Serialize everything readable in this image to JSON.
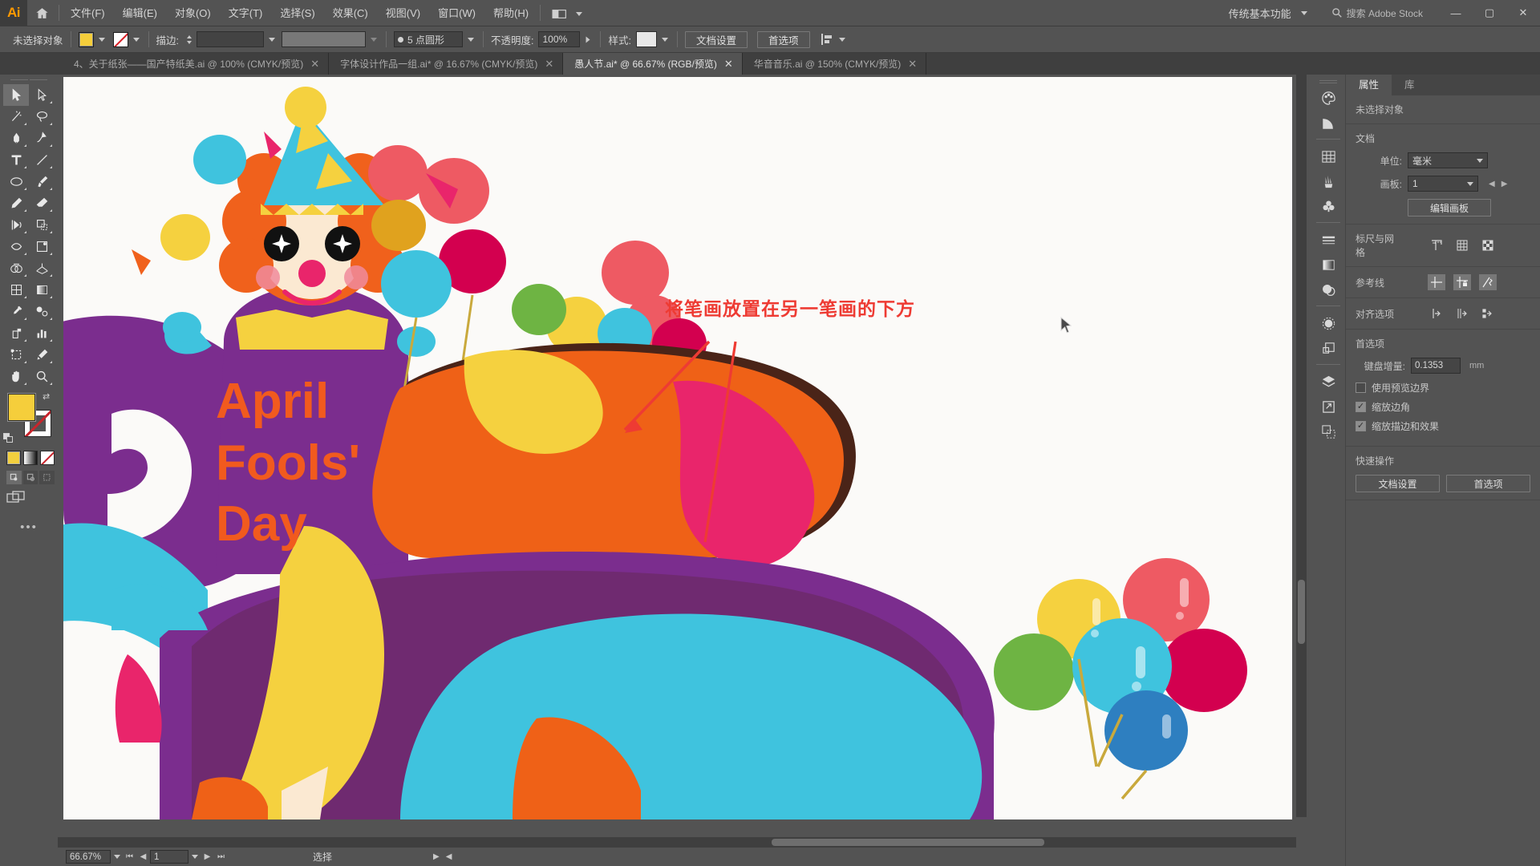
{
  "app": {
    "name": "Adobe Illustrator",
    "logo_text": "Ai",
    "workspace": "传统基本功能",
    "search_placeholder": "搜索 Adobe Stock"
  },
  "menubar": {
    "items": [
      {
        "label": "文件(F)"
      },
      {
        "label": "编辑(E)"
      },
      {
        "label": "对象(O)"
      },
      {
        "label": "文字(T)"
      },
      {
        "label": "选择(S)"
      },
      {
        "label": "效果(C)"
      },
      {
        "label": "视图(V)"
      },
      {
        "label": "窗口(W)"
      },
      {
        "label": "帮助(H)"
      }
    ],
    "window_minimize": "—",
    "window_maximize": "▢",
    "window_close": "✕"
  },
  "controlbar": {
    "selection_status": "未选择对象",
    "fill_color": "#F5CE3B",
    "stroke_label": "描边:",
    "stroke_weight": "",
    "stroke_profile": "",
    "brush_definition": "5 点圆形",
    "opacity_label": "不透明度:",
    "opacity_value": "100%",
    "style_label": "样式:",
    "doc_setup_button": "文档设置",
    "preferences_button": "首选项"
  },
  "tabs": [
    {
      "title": "4、关于纸张——国产特纸美.ai @ 100% (CMYK/预览)",
      "active": false,
      "close": "✕"
    },
    {
      "title": "字体设计作品一组.ai* @ 16.67% (CMYK/预览)",
      "active": false,
      "close": "✕"
    },
    {
      "title": "愚人节.ai* @ 66.67% (RGB/预览)",
      "active": true,
      "close": "✕"
    },
    {
      "title": "华音音乐.ai @ 150% (CMYK/预览)",
      "active": false,
      "close": "✕"
    }
  ],
  "toolbar": {
    "tools": [
      {
        "name": "selection-tool",
        "active": true
      },
      {
        "name": "direct-selection-tool",
        "active": false
      },
      {
        "name": "magic-wand-tool",
        "active": false
      },
      {
        "name": "lasso-tool",
        "active": false
      },
      {
        "name": "pen-tool",
        "active": false
      },
      {
        "name": "curvature-tool",
        "active": false
      },
      {
        "name": "type-tool",
        "active": false
      },
      {
        "name": "line-segment-tool",
        "active": false
      },
      {
        "name": "ellipse-tool",
        "active": false
      },
      {
        "name": "paintbrush-tool",
        "active": false
      },
      {
        "name": "pencil-tool",
        "active": false
      },
      {
        "name": "eraser-tool",
        "active": false
      },
      {
        "name": "rotate-tool",
        "active": false
      },
      {
        "name": "scale-tool",
        "active": false
      },
      {
        "name": "width-tool",
        "active": false
      },
      {
        "name": "free-transform-tool",
        "active": false
      },
      {
        "name": "shape-builder-tool",
        "active": false
      },
      {
        "name": "perspective-grid-tool",
        "active": false
      },
      {
        "name": "mesh-tool",
        "active": false
      },
      {
        "name": "gradient-tool",
        "active": false
      },
      {
        "name": "eyedropper-tool",
        "active": false
      },
      {
        "name": "blend-tool",
        "active": false
      },
      {
        "name": "symbol-sprayer-tool",
        "active": false
      },
      {
        "name": "column-graph-tool",
        "active": false
      },
      {
        "name": "artboard-tool",
        "active": false
      },
      {
        "name": "slice-tool",
        "active": false
      },
      {
        "name": "hand-tool",
        "active": false
      },
      {
        "name": "zoom-tool",
        "active": false
      }
    ],
    "fill_color": "#F5CE3B",
    "stroke_color": "none",
    "dots_label": "•••"
  },
  "canvas": {
    "annotation_text": "将笔画放置在另一笔画的下方",
    "annotation_color": "#EE3B33",
    "artwork_title_lines": [
      "April",
      "Fools'",
      "Day"
    ],
    "artwork_title_color": "#F15A1E",
    "palette": {
      "purple": "#7B2D8E",
      "dark_brown": "#4A2418",
      "orange": "#EF6117",
      "yellow": "#F5D13F",
      "cyan": "#3FC3DE",
      "pink": "#E9256B",
      "red_pink": "#EE5A63",
      "crimson": "#D3004F",
      "green": "#6EB443",
      "blue": "#2E7FC0",
      "skin": "#FBE9D2"
    }
  },
  "statusbar": {
    "zoom_level": "66.67%",
    "page_number": "1",
    "status_text": "选择",
    "nav_first": "⏮",
    "nav_prev": "◀",
    "nav_next": "▶",
    "nav_last": "⏭"
  },
  "dockstrip": {
    "icons": [
      {
        "name": "color-panel-icon"
      },
      {
        "name": "color-guide-icon"
      },
      {
        "name": "swatches-panel-icon"
      },
      {
        "name": "brushes-panel-icon"
      },
      {
        "name": "symbols-panel-icon"
      },
      {
        "name": "stroke-panel-icon"
      },
      {
        "name": "gradient-panel-icon"
      },
      {
        "name": "transparency-panel-icon"
      },
      {
        "name": "appearance-panel-icon"
      },
      {
        "name": "transform-panel-icon"
      },
      {
        "name": "layers-panel-icon"
      },
      {
        "name": "export-panel-icon"
      },
      {
        "name": "artboards-panel-icon"
      }
    ]
  },
  "properties": {
    "tabs": [
      {
        "label": "属性",
        "active": true
      },
      {
        "label": "库",
        "active": false
      }
    ],
    "selection_status": "未选择对象",
    "document": {
      "heading": "文档",
      "units_label": "单位:",
      "units_value": "毫米",
      "artboard_label": "画板:",
      "artboard_value": "1",
      "edit_artboards_button": "编辑画板"
    },
    "rulers_grids": {
      "label": "标尺与网格",
      "icons": [
        "show-rulers-icon",
        "show-grid-icon",
        "show-transparency-grid-icon"
      ]
    },
    "guides": {
      "label": "参考线",
      "icons": [
        "show-guides-icon",
        "lock-guides-icon",
        "smart-guides-icon"
      ]
    },
    "align_options": {
      "label": "对齐选项",
      "icons": [
        "snap-to-point-icon",
        "snap-to-grid-icon",
        "snap-to-pixel-icon"
      ]
    },
    "preferences": {
      "heading": "首选项",
      "keyboard_increment_label": "键盘增量:",
      "keyboard_increment_value": "0.1353",
      "keyboard_increment_unit": "mm",
      "checkboxes": [
        {
          "label": "使用预览边界",
          "checked": false
        },
        {
          "label": "缩放边角",
          "checked": true
        },
        {
          "label": "缩放描边和效果",
          "checked": true
        }
      ]
    },
    "quick_actions": {
      "heading": "快速操作",
      "doc_setup_button": "文档设置",
      "preferences_button": "首选项"
    }
  }
}
